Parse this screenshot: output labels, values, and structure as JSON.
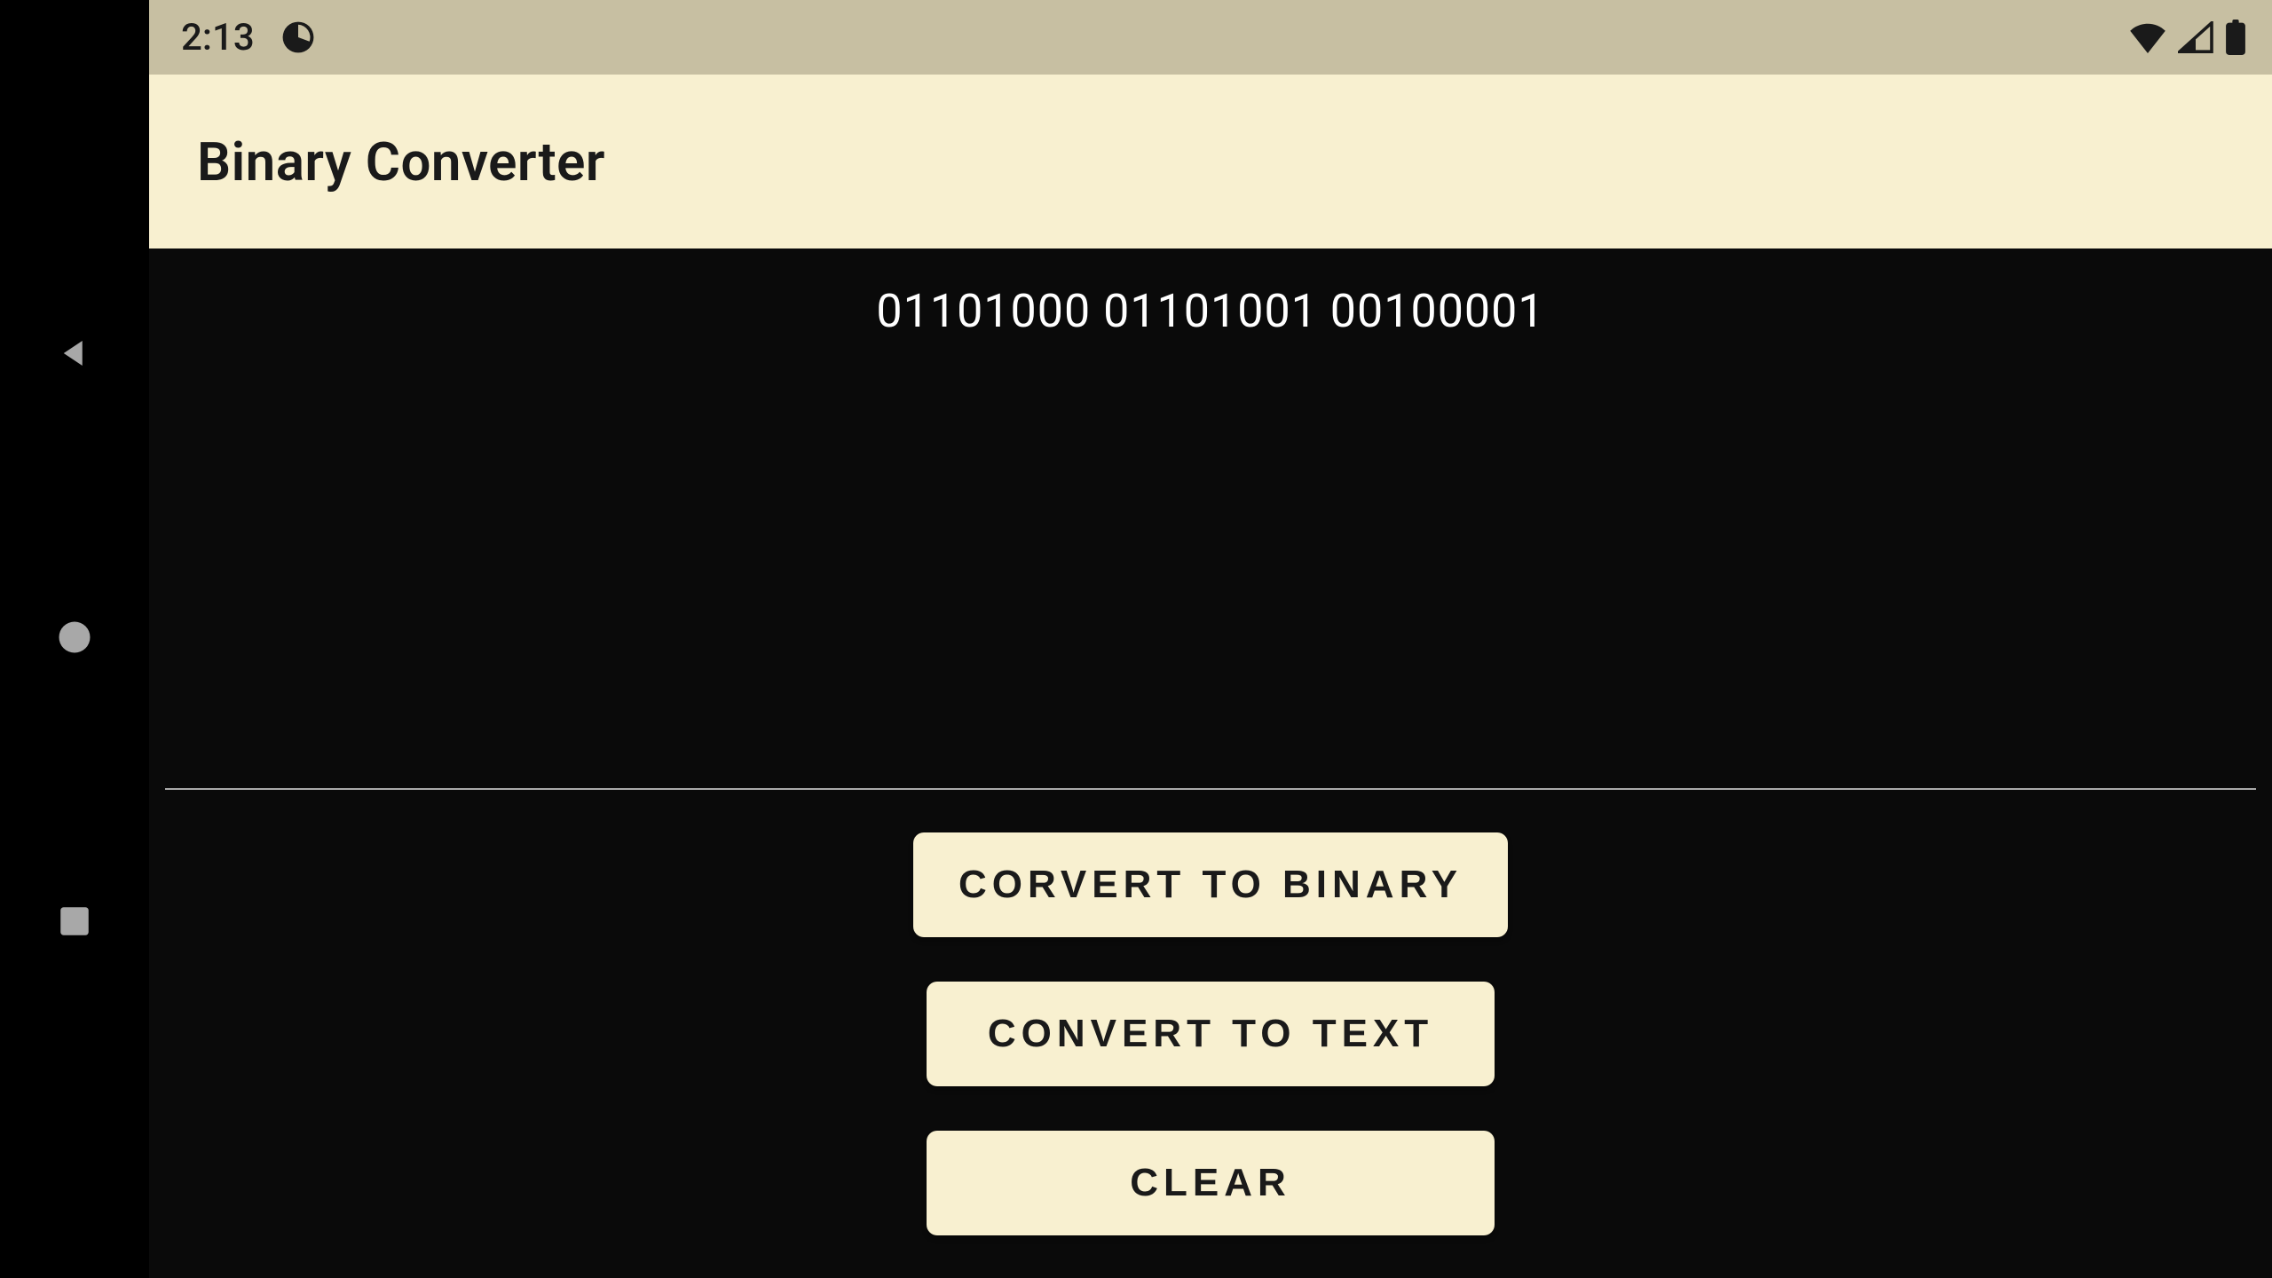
{
  "status_bar": {
    "time": "2:13"
  },
  "header": {
    "title": "Binary Converter"
  },
  "main": {
    "input_value": "01101000 01101001 00100001"
  },
  "buttons": {
    "convert_to_binary": "CORVERT TO BINARY",
    "convert_to_text": "CONVERT TO TEXT",
    "clear": "CLEAR"
  }
}
